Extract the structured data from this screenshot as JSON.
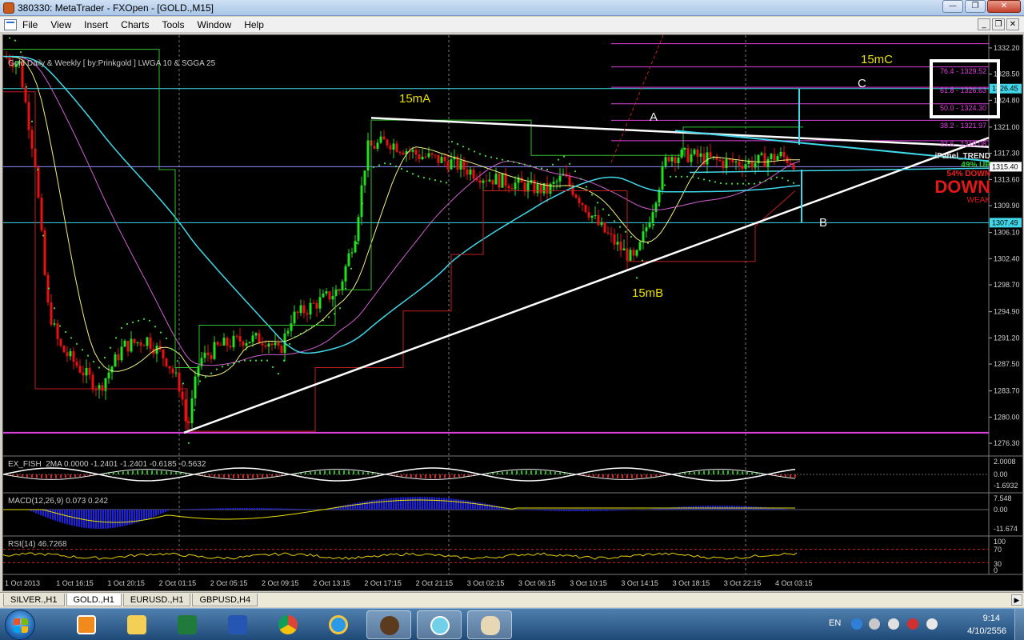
{
  "window": {
    "title": "380330: MetaTrader - FXOpen - [GOLD.,M15]",
    "minimize": "—",
    "restore": "❐",
    "close": "✕"
  },
  "menu": {
    "items": [
      "File",
      "View",
      "Insert",
      "Charts",
      "Tools",
      "Window",
      "Help"
    ],
    "mdi": [
      "_",
      "❐",
      "✕"
    ]
  },
  "chart": {
    "title": "Gold Daily & Weekly [ by:Prinkgold ] LWGA 10 & SGGA 25",
    "wave_labels": [
      "15mA",
      "15mB",
      "15mC"
    ],
    "point_labels": [
      "A",
      "B",
      "C"
    ],
    "price_axis": [
      "1332.20",
      "1328.50",
      "1324.80",
      "1321.00",
      "1317.30",
      "1313.60",
      "1309.90",
      "1306.10",
      "1302.40",
      "1298.70",
      "1294.90",
      "1291.20",
      "1287.50",
      "1283.70",
      "1280.00",
      "1276.30"
    ],
    "current_price": "1315.40",
    "cyan_level_high": "1326.45",
    "cyan_level_low": "1307.49",
    "fibo_levels": [
      "76.4 - 1329.52",
      "61.8 - 1326.63",
      "50.0 - 1324.30",
      "38.2 - 1321.97",
      "23.6 - 1319.08"
    ],
    "time_axis": [
      "1 Oct 2013",
      "1 Oct 16:15",
      "1 Oct 20:15",
      "2 Oct 01:15",
      "2 Oct 05:15",
      "2 Oct 09:15",
      "2 Oct 13:15",
      "2 Oct 17:15",
      "2 Oct 21:15",
      "3 Oct 02:15",
      "3 Oct 06:15",
      "3 Oct 10:15",
      "3 Oct 14:15",
      "3 Oct 18:15",
      "3 Oct 22:15",
      "4 Oct 03:15"
    ],
    "colors": {
      "background": "#000000",
      "bull_candle": "#20e020",
      "bear_candle": "#e81010",
      "trendline": "#ffffff",
      "channel": "#40d8e8",
      "fibo": "#e040e0",
      "grid": "#777777"
    }
  },
  "ipanel": {
    "title": "iPanel_TREND",
    "up_label": "UP",
    "up_pct": "49%",
    "down_pct": "54%",
    "down_label": "DOWN",
    "direction": "DOWN",
    "strength": "WEAK"
  },
  "indicators": {
    "fish": {
      "label": "EX_FISH_2MA 0.0000 -1.2401 -1.2401 -0.6185 -0.5632",
      "scale": [
        "2.0008",
        "0.00",
        "-1.6932"
      ]
    },
    "macd": {
      "label": "MACD(12,26,9) 0.073 0.242",
      "scale": [
        "7.548",
        "0.00",
        "-11.674"
      ]
    },
    "rsi": {
      "label": "RSI(14) 46.7268",
      "scale": [
        "100",
        "70",
        "30",
        "0"
      ]
    }
  },
  "tabs": [
    "SILVER.,H1",
    "GOLD.,H1",
    "EURUSD.,H1",
    "GBPUSD,H4"
  ],
  "active_tab": "GOLD.,H1",
  "taskbar": {
    "icons": [
      "media-player-icon",
      "file-explorer-icon",
      "excel-icon",
      "word-icon",
      "chrome-icon",
      "ie-icon",
      "metatrader-icon",
      "app-icon",
      "paint-icon"
    ],
    "lang": "EN",
    "time": "9:14",
    "date": "4/10/2556"
  }
}
